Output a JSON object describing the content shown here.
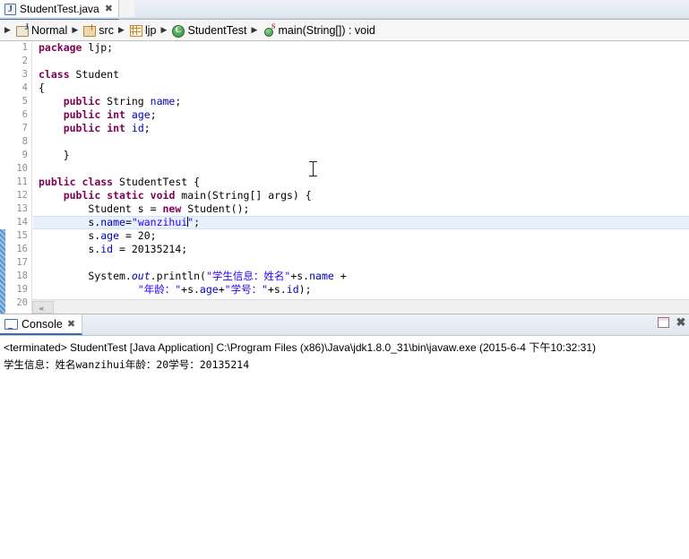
{
  "editor_tab": {
    "icon": "java-file-icon",
    "label": "StudentTest.java",
    "close": "✖"
  },
  "breadcrumb": {
    "items": [
      {
        "icon": "java-project-icon",
        "label": "Normal"
      },
      {
        "icon": "source-folder-icon",
        "label": "src"
      },
      {
        "icon": "package-icon",
        "label": "ljp"
      },
      {
        "icon": "java-class-icon",
        "label": "StudentTest"
      },
      {
        "icon": "java-method-icon",
        "label": "main(String[]) : void"
      }
    ],
    "separator": "▶"
  },
  "editor": {
    "line_numbers": [
      "1",
      "2",
      "3",
      "4",
      "5",
      "6",
      "7",
      "8",
      "9",
      "10",
      "11",
      "12",
      "13",
      "14",
      "15",
      "16",
      "17",
      "18",
      "19",
      "20"
    ],
    "current_line": 14,
    "lines": [
      "package ljp;",
      "",
      "class Student",
      "{",
      "    public String name;",
      "    public int age;",
      "    public int id;",
      "",
      "    }",
      "",
      "public class StudentTest {",
      "    public static void main(String[] args) {",
      "        Student s = new Student();",
      "        s.name=\"wanzihui\";",
      "        s.age = 20;",
      "        s.id = 20135214;",
      "",
      "        System.out.println(\"学生信息：姓名\"+s.name +",
      "                \"年龄：\"+s.age+\"学号：\"+s.id);",
      ""
    ],
    "scroll_left_arrow": "«"
  },
  "console": {
    "tab_label": "Console",
    "tab_close": "✖",
    "maximize_icon": "maximize-icon",
    "close_icon": "✖",
    "status_line": "<terminated> StudentTest [Java Application] C:\\Program Files (x86)\\Java\\jdk1.8.0_31\\bin\\javaw.exe (2015-6-4 下午10:32:31)",
    "output": "学生信息：姓名wanzihui年龄：20学号：20135214"
  },
  "colors": {
    "keyword": "#7f0055",
    "string": "#2a00ff",
    "field": "#0000c0",
    "line_number": "#8e8e8e",
    "current_line_bg": "#e8f0fb",
    "tab_underline": "#3a6ea5",
    "change_bar": "#5b93cc"
  }
}
